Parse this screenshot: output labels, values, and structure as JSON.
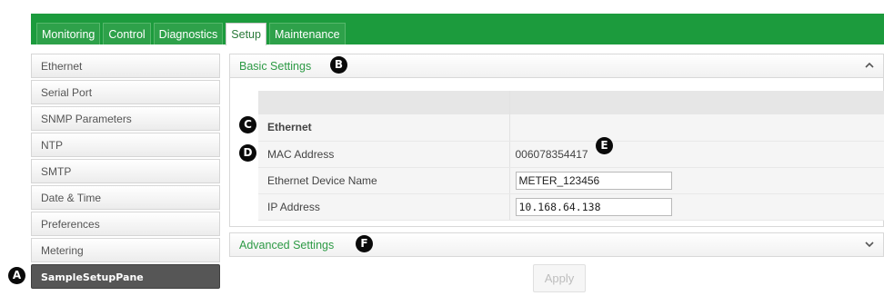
{
  "tabs": [
    {
      "label": "Monitoring",
      "active": false
    },
    {
      "label": "Control",
      "active": false
    },
    {
      "label": "Diagnostics",
      "active": false
    },
    {
      "label": "Setup",
      "active": true
    },
    {
      "label": "Maintenance",
      "active": false
    }
  ],
  "sidebar": {
    "items": [
      {
        "label": "Ethernet"
      },
      {
        "label": "Serial Port"
      },
      {
        "label": "SNMP Parameters"
      },
      {
        "label": "NTP"
      },
      {
        "label": "SMTP"
      },
      {
        "label": "Date & Time"
      },
      {
        "label": "Preferences"
      },
      {
        "label": "Metering"
      },
      {
        "label": "SampleSetupPane",
        "selected": true
      }
    ]
  },
  "basic_settings": {
    "title": "Basic Settings",
    "section_label": "Ethernet",
    "mac_label": "MAC Address",
    "mac_value": "006078354417",
    "device_name_label": "Ethernet Device Name",
    "device_name_value": "METER_123456",
    "ip_label": "IP Address",
    "ip_value": "10.168.64.138"
  },
  "advanced_settings": {
    "title": "Advanced Settings"
  },
  "apply_label": "Apply",
  "markers": {
    "a": "A",
    "b": "B",
    "c": "C",
    "d": "D",
    "e": "E",
    "f": "F"
  },
  "colors": {
    "brand_green": "#1c9b3d",
    "link_green": "#2d9a45",
    "selected_gray": "#565656"
  }
}
